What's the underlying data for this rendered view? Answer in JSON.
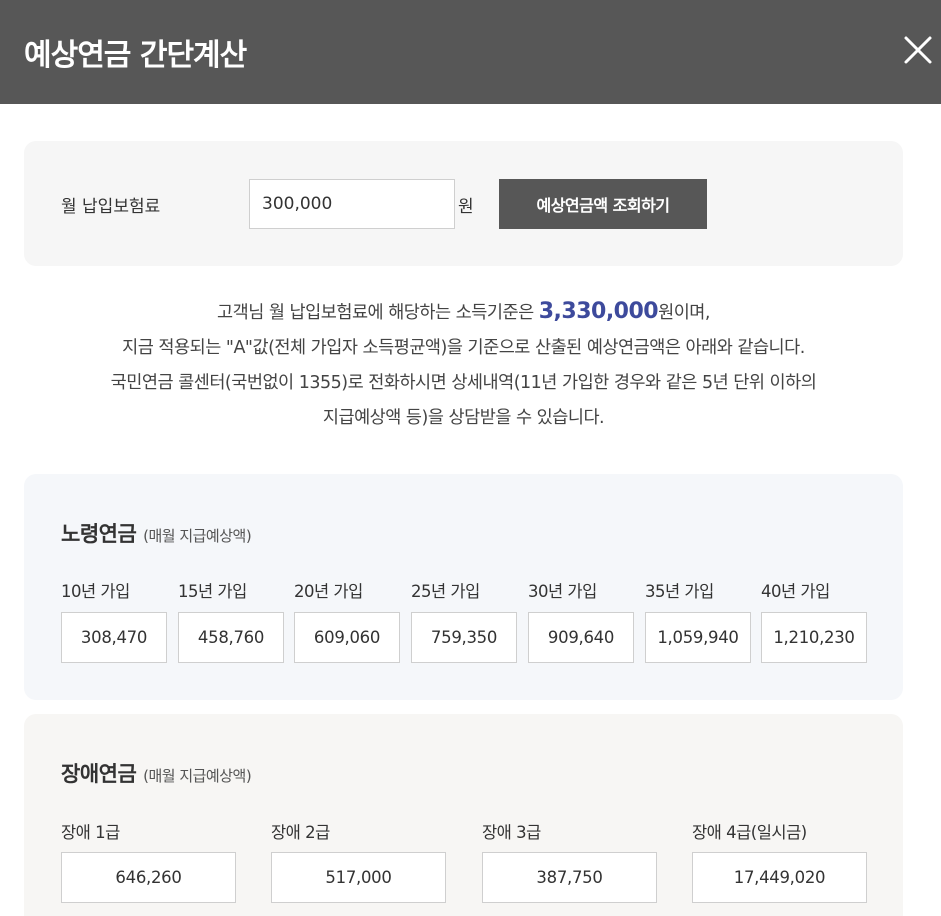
{
  "header": {
    "title": "예상연금 간단계산"
  },
  "premium": {
    "label": "월 납입보험료",
    "value": "300,000",
    "unit": "원",
    "query_label": "예상연금액 조회하기"
  },
  "description": {
    "line1_prefix": "고객님 월 납입보험료에 해당하는 소득기준은 ",
    "income": "3,330,000",
    "line1_suffix": "원이며,",
    "line2": "지금 적용되는 \"A\"값(전체 가입자 소득평균액)을 기준으로 산출된 예상연금액은 아래와 같습니다.",
    "line3": "국민연금 콜센터(국번없이 1355)로 전화하시면 상세내역(11년 가입한 경우와 같은 5년 단위 이하의",
    "line4": "지급예상액 등)을 상담받을 수 있습니다."
  },
  "old_age": {
    "title": "노령연금",
    "subtitle": "(매월 지급예상액)",
    "items": [
      {
        "label": "10년 가입",
        "value": "308,470"
      },
      {
        "label": "15년 가입",
        "value": "458,760"
      },
      {
        "label": "20년 가입",
        "value": "609,060"
      },
      {
        "label": "25년 가입",
        "value": "759,350"
      },
      {
        "label": "30년 가입",
        "value": "909,640"
      },
      {
        "label": "35년 가입",
        "value": "1,059,940"
      },
      {
        "label": "40년 가입",
        "value": "1,210,230"
      }
    ]
  },
  "disability": {
    "title": "장애연금",
    "subtitle": "(매월 지급예상액)",
    "items": [
      {
        "label": "장애 1급",
        "value": "646,260"
      },
      {
        "label": "장애 2급",
        "value": "517,000"
      },
      {
        "label": "장애 3급",
        "value": "387,750"
      },
      {
        "label": "장애 4급(일시금)",
        "value": "17,449,020"
      }
    ]
  }
}
